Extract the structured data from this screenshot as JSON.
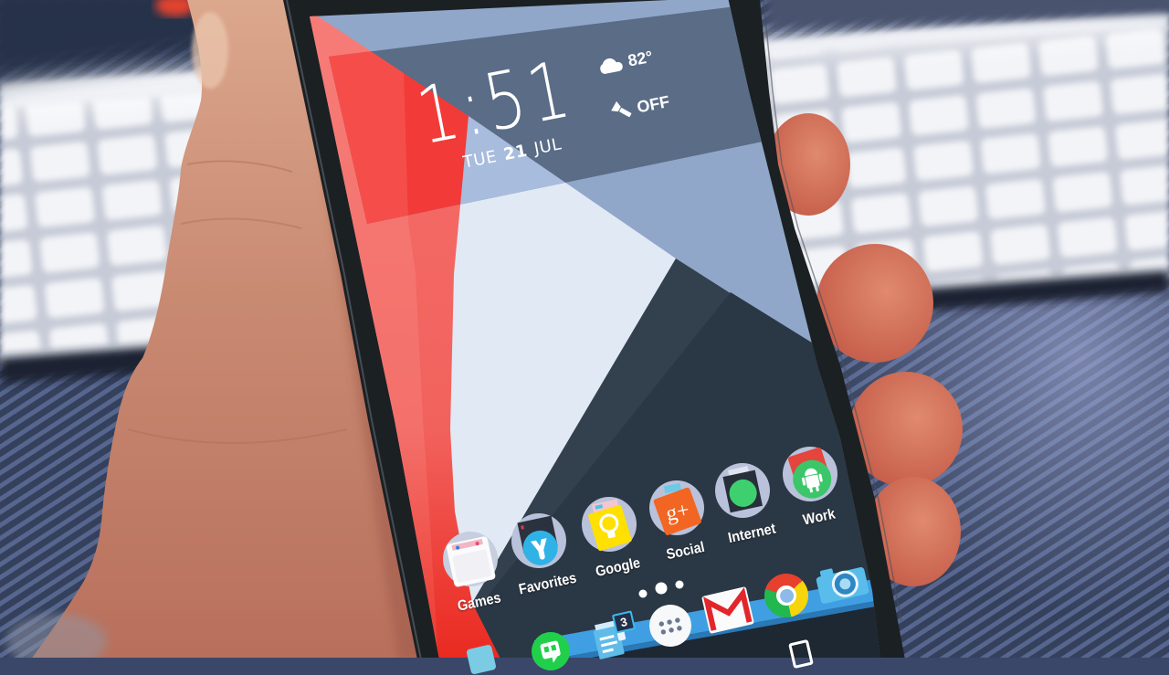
{
  "screen": {
    "clock_widget": {
      "time": "1:51",
      "day": "TUE",
      "date": "21",
      "month": "JUL",
      "weather": {
        "icon": "cloud-icon",
        "temperature": "82°"
      },
      "flashlight": {
        "icon": "flashlight-icon",
        "state": "OFF"
      }
    },
    "home_folders": [
      {
        "label": "Games",
        "icon": "games-folder-icon"
      },
      {
        "label": "Favorites",
        "icon": "favorites-folder-icon"
      },
      {
        "label": "Google",
        "icon": "google-folder-icon"
      },
      {
        "label": "Social",
        "icon": "social-folder-icon",
        "glyph": "g+"
      },
      {
        "label": "Internet",
        "icon": "internet-folder-icon"
      },
      {
        "label": "Work",
        "icon": "work-folder-icon"
      }
    ],
    "page_indicator": {
      "page_count": 3,
      "active_page": 2
    },
    "dock": [
      {
        "icon": "partial-app-icon"
      },
      {
        "icon": "hangouts-icon"
      },
      {
        "icon": "messenger-icon",
        "badge": "3"
      },
      {
        "icon": "app-drawer-icon"
      },
      {
        "icon": "gmail-icon"
      },
      {
        "icon": "chrome-icon"
      },
      {
        "icon": "camera-icon"
      }
    ],
    "navigation_bar": {
      "buttons": [
        "home-button-icon"
      ]
    }
  },
  "theme_colors": {
    "wallpaper_red": "#f2625d",
    "wallpaper_slate": "#33414e",
    "wallpaper_steel_blue": "#90a7c9",
    "wallpaper_white": "#e1e9f5",
    "widget_backdrop": "#5a6c86",
    "dock_blue": "#3f9fe2",
    "label_text": "#ffffff"
  }
}
